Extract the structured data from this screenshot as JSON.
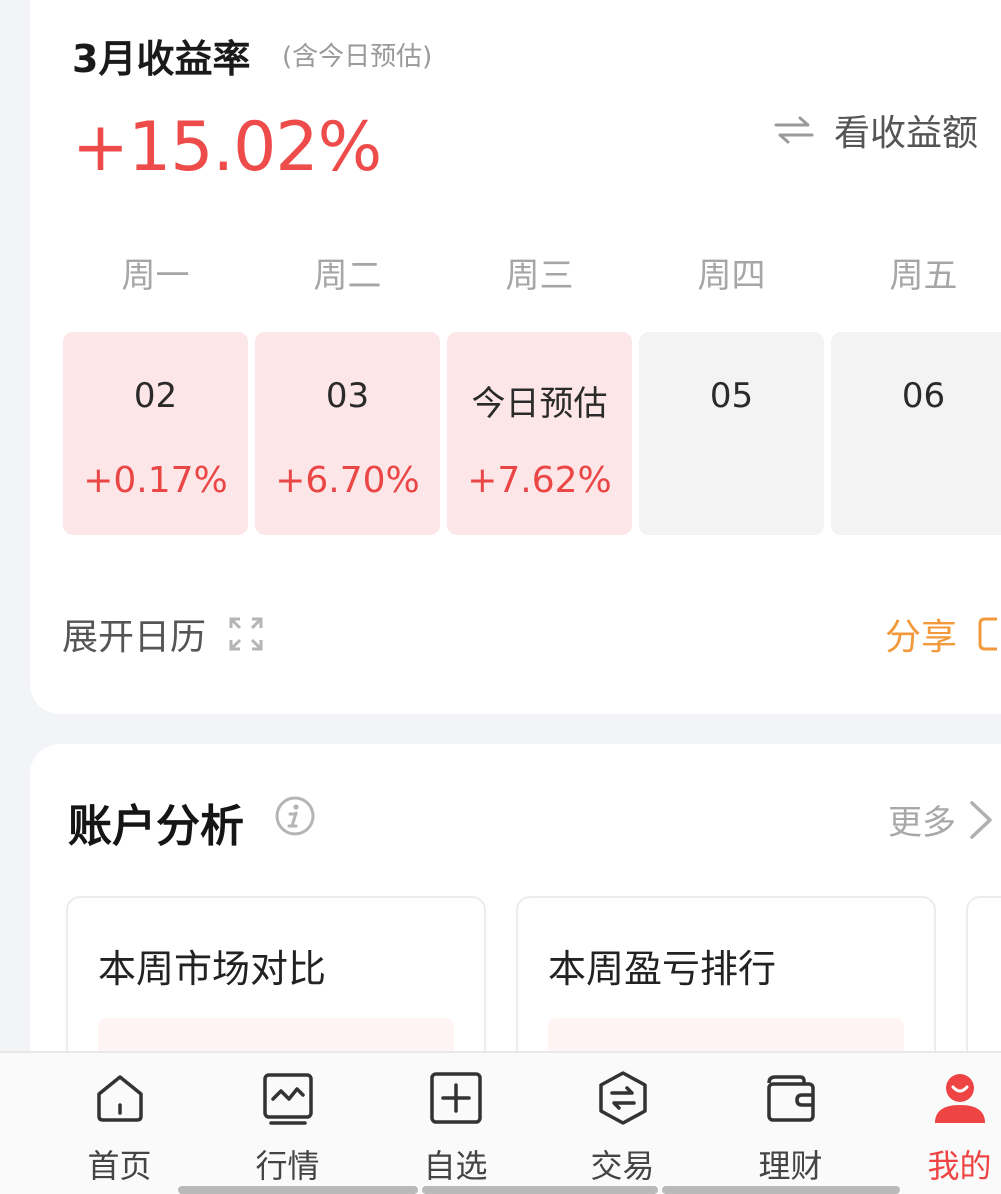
{
  "returns": {
    "title": "3月收益率",
    "title_note": "(含今日预估)",
    "rate": "+15.02%",
    "toggle_label": "看收益额",
    "weekdays": [
      "周一",
      "周二",
      "周三",
      "周四",
      "周五"
    ],
    "days": [
      {
        "date": "02",
        "rate": "+0.17%"
      },
      {
        "date": "03",
        "rate": "+6.70%"
      },
      {
        "date": "今日预估",
        "rate": "+7.62%"
      },
      {
        "date": "05",
        "rate": ""
      },
      {
        "date": "06",
        "rate": ""
      }
    ],
    "expand_label": "展开日历",
    "share_label": "分享"
  },
  "analysis": {
    "title": "账户分析",
    "more_label": "更多",
    "cards": [
      {
        "title": "本周市场对比"
      },
      {
        "title": "本周盈亏排行"
      }
    ]
  },
  "tabbar": {
    "items": [
      {
        "label": "首页",
        "icon": "home-icon"
      },
      {
        "label": "行情",
        "icon": "market-chart-icon"
      },
      {
        "label": "自选",
        "icon": "watchlist-add-icon"
      },
      {
        "label": "交易",
        "icon": "trade-exchange-icon"
      },
      {
        "label": "理财",
        "icon": "wallet-icon"
      },
      {
        "label": "我的",
        "icon": "profile-icon"
      }
    ],
    "active": "我的"
  },
  "colors": {
    "up_red": "#ee4b4b",
    "up_bg": "#fde6e7",
    "neutral_bg": "#f3f3f3",
    "share_orange": "#f29a3b",
    "active_tab": "#ee4444"
  }
}
